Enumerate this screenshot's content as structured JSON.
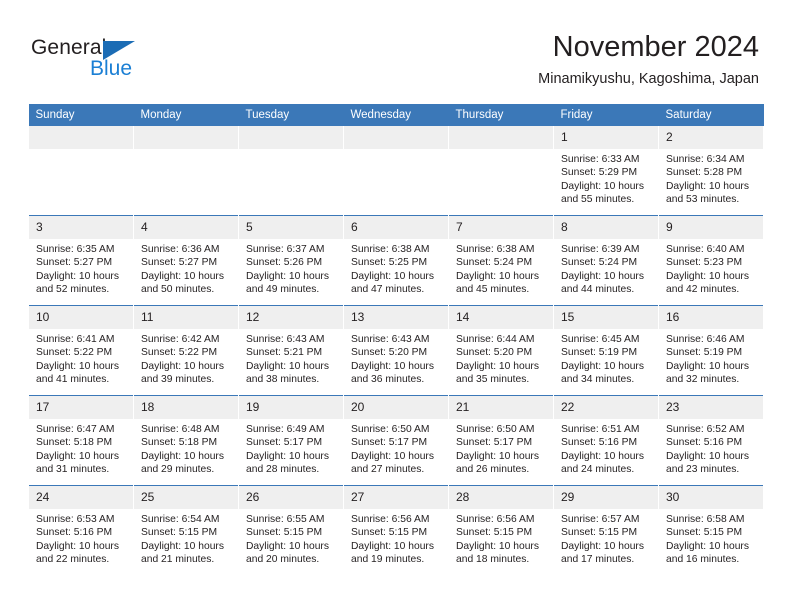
{
  "brand": {
    "name_part1": "General",
    "name_part2": "Blue",
    "triangle_color": "#1b6cb5",
    "blue_text_color": "#1b7fd4"
  },
  "header": {
    "title": "November 2024",
    "subtitle": "Minamikyushu, Kagoshima, Japan",
    "accent_color": "#3b78b8",
    "daynum_strip_color": "#efefef"
  },
  "calendar": {
    "weekday_headers": [
      "Sunday",
      "Monday",
      "Tuesday",
      "Wednesday",
      "Thursday",
      "Friday",
      "Saturday"
    ],
    "weeks": [
      [
        {
          "day": "",
          "empty": true,
          "sunrise": "",
          "sunset": "",
          "daylight_line1": "",
          "daylight_line2": ""
        },
        {
          "day": "",
          "empty": true,
          "sunrise": "",
          "sunset": "",
          "daylight_line1": "",
          "daylight_line2": ""
        },
        {
          "day": "",
          "empty": true,
          "sunrise": "",
          "sunset": "",
          "daylight_line1": "",
          "daylight_line2": ""
        },
        {
          "day": "",
          "empty": true,
          "sunrise": "",
          "sunset": "",
          "daylight_line1": "",
          "daylight_line2": ""
        },
        {
          "day": "",
          "empty": true,
          "sunrise": "",
          "sunset": "",
          "daylight_line1": "",
          "daylight_line2": ""
        },
        {
          "day": "1",
          "sunrise": "Sunrise: 6:33 AM",
          "sunset": "Sunset: 5:29 PM",
          "daylight_line1": "Daylight: 10 hours",
          "daylight_line2": "and 55 minutes."
        },
        {
          "day": "2",
          "sunrise": "Sunrise: 6:34 AM",
          "sunset": "Sunset: 5:28 PM",
          "daylight_line1": "Daylight: 10 hours",
          "daylight_line2": "and 53 minutes."
        }
      ],
      [
        {
          "day": "3",
          "sunrise": "Sunrise: 6:35 AM",
          "sunset": "Sunset: 5:27 PM",
          "daylight_line1": "Daylight: 10 hours",
          "daylight_line2": "and 52 minutes."
        },
        {
          "day": "4",
          "sunrise": "Sunrise: 6:36 AM",
          "sunset": "Sunset: 5:27 PM",
          "daylight_line1": "Daylight: 10 hours",
          "daylight_line2": "and 50 minutes."
        },
        {
          "day": "5",
          "sunrise": "Sunrise: 6:37 AM",
          "sunset": "Sunset: 5:26 PM",
          "daylight_line1": "Daylight: 10 hours",
          "daylight_line2": "and 49 minutes."
        },
        {
          "day": "6",
          "sunrise": "Sunrise: 6:38 AM",
          "sunset": "Sunset: 5:25 PM",
          "daylight_line1": "Daylight: 10 hours",
          "daylight_line2": "and 47 minutes."
        },
        {
          "day": "7",
          "sunrise": "Sunrise: 6:38 AM",
          "sunset": "Sunset: 5:24 PM",
          "daylight_line1": "Daylight: 10 hours",
          "daylight_line2": "and 45 minutes."
        },
        {
          "day": "8",
          "sunrise": "Sunrise: 6:39 AM",
          "sunset": "Sunset: 5:24 PM",
          "daylight_line1": "Daylight: 10 hours",
          "daylight_line2": "and 44 minutes."
        },
        {
          "day": "9",
          "sunrise": "Sunrise: 6:40 AM",
          "sunset": "Sunset: 5:23 PM",
          "daylight_line1": "Daylight: 10 hours",
          "daylight_line2": "and 42 minutes."
        }
      ],
      [
        {
          "day": "10",
          "sunrise": "Sunrise: 6:41 AM",
          "sunset": "Sunset: 5:22 PM",
          "daylight_line1": "Daylight: 10 hours",
          "daylight_line2": "and 41 minutes."
        },
        {
          "day": "11",
          "sunrise": "Sunrise: 6:42 AM",
          "sunset": "Sunset: 5:22 PM",
          "daylight_line1": "Daylight: 10 hours",
          "daylight_line2": "and 39 minutes."
        },
        {
          "day": "12",
          "sunrise": "Sunrise: 6:43 AM",
          "sunset": "Sunset: 5:21 PM",
          "daylight_line1": "Daylight: 10 hours",
          "daylight_line2": "and 38 minutes."
        },
        {
          "day": "13",
          "sunrise": "Sunrise: 6:43 AM",
          "sunset": "Sunset: 5:20 PM",
          "daylight_line1": "Daylight: 10 hours",
          "daylight_line2": "and 36 minutes."
        },
        {
          "day": "14",
          "sunrise": "Sunrise: 6:44 AM",
          "sunset": "Sunset: 5:20 PM",
          "daylight_line1": "Daylight: 10 hours",
          "daylight_line2": "and 35 minutes."
        },
        {
          "day": "15",
          "sunrise": "Sunrise: 6:45 AM",
          "sunset": "Sunset: 5:19 PM",
          "daylight_line1": "Daylight: 10 hours",
          "daylight_line2": "and 34 minutes."
        },
        {
          "day": "16",
          "sunrise": "Sunrise: 6:46 AM",
          "sunset": "Sunset: 5:19 PM",
          "daylight_line1": "Daylight: 10 hours",
          "daylight_line2": "and 32 minutes."
        }
      ],
      [
        {
          "day": "17",
          "sunrise": "Sunrise: 6:47 AM",
          "sunset": "Sunset: 5:18 PM",
          "daylight_line1": "Daylight: 10 hours",
          "daylight_line2": "and 31 minutes."
        },
        {
          "day": "18",
          "sunrise": "Sunrise: 6:48 AM",
          "sunset": "Sunset: 5:18 PM",
          "daylight_line1": "Daylight: 10 hours",
          "daylight_line2": "and 29 minutes."
        },
        {
          "day": "19",
          "sunrise": "Sunrise: 6:49 AM",
          "sunset": "Sunset: 5:17 PM",
          "daylight_line1": "Daylight: 10 hours",
          "daylight_line2": "and 28 minutes."
        },
        {
          "day": "20",
          "sunrise": "Sunrise: 6:50 AM",
          "sunset": "Sunset: 5:17 PM",
          "daylight_line1": "Daylight: 10 hours",
          "daylight_line2": "and 27 minutes."
        },
        {
          "day": "21",
          "sunrise": "Sunrise: 6:50 AM",
          "sunset": "Sunset: 5:17 PM",
          "daylight_line1": "Daylight: 10 hours",
          "daylight_line2": "and 26 minutes."
        },
        {
          "day": "22",
          "sunrise": "Sunrise: 6:51 AM",
          "sunset": "Sunset: 5:16 PM",
          "daylight_line1": "Daylight: 10 hours",
          "daylight_line2": "and 24 minutes."
        },
        {
          "day": "23",
          "sunrise": "Sunrise: 6:52 AM",
          "sunset": "Sunset: 5:16 PM",
          "daylight_line1": "Daylight: 10 hours",
          "daylight_line2": "and 23 minutes."
        }
      ],
      [
        {
          "day": "24",
          "sunrise": "Sunrise: 6:53 AM",
          "sunset": "Sunset: 5:16 PM",
          "daylight_line1": "Daylight: 10 hours",
          "daylight_line2": "and 22 minutes."
        },
        {
          "day": "25",
          "sunrise": "Sunrise: 6:54 AM",
          "sunset": "Sunset: 5:15 PM",
          "daylight_line1": "Daylight: 10 hours",
          "daylight_line2": "and 21 minutes."
        },
        {
          "day": "26",
          "sunrise": "Sunrise: 6:55 AM",
          "sunset": "Sunset: 5:15 PM",
          "daylight_line1": "Daylight: 10 hours",
          "daylight_line2": "and 20 minutes."
        },
        {
          "day": "27",
          "sunrise": "Sunrise: 6:56 AM",
          "sunset": "Sunset: 5:15 PM",
          "daylight_line1": "Daylight: 10 hours",
          "daylight_line2": "and 19 minutes."
        },
        {
          "day": "28",
          "sunrise": "Sunrise: 6:56 AM",
          "sunset": "Sunset: 5:15 PM",
          "daylight_line1": "Daylight: 10 hours",
          "daylight_line2": "and 18 minutes."
        },
        {
          "day": "29",
          "sunrise": "Sunrise: 6:57 AM",
          "sunset": "Sunset: 5:15 PM",
          "daylight_line1": "Daylight: 10 hours",
          "daylight_line2": "and 17 minutes."
        },
        {
          "day": "30",
          "sunrise": "Sunrise: 6:58 AM",
          "sunset": "Sunset: 5:15 PM",
          "daylight_line1": "Daylight: 10 hours",
          "daylight_line2": "and 16 minutes."
        }
      ]
    ]
  }
}
